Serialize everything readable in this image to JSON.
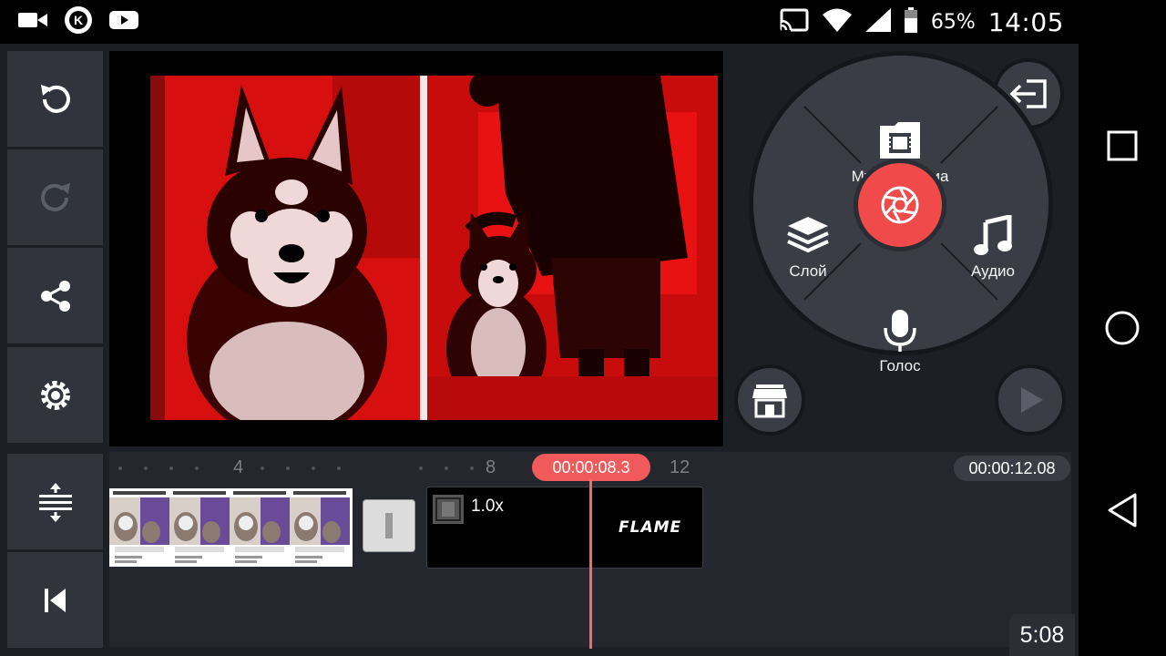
{
  "status_bar": {
    "icons_left": [
      "video-camera-icon",
      "kinemaster-k-icon",
      "youtube-icon"
    ],
    "icons_right": [
      "cast-icon",
      "wifi-icon",
      "cell-signal-icon",
      "battery-icon"
    ],
    "battery": "65%",
    "time": "14:05"
  },
  "toolbar_left": [
    "undo-icon",
    "redo-icon",
    "share-icon",
    "settings-gear-icon",
    "timeline-height-icon",
    "skip-to-start-icon"
  ],
  "menu_wheel": {
    "media": "Мультимедиа",
    "layer": "Слой",
    "audio": "Аудио",
    "voice": "Голос"
  },
  "timeline": {
    "ruler_labels": [
      "4",
      "8",
      "12"
    ],
    "playhead_time": "00:00:08.3",
    "total_time": "00:00:12.08",
    "clip2_speed": "1.0x",
    "clip2_title": "FLAME"
  },
  "duration_badge": "5:08",
  "colors": {
    "accent": "#f04a4a",
    "panel": "#31343d",
    "background": "#1d1f26",
    "video_tint": "#e01010"
  }
}
